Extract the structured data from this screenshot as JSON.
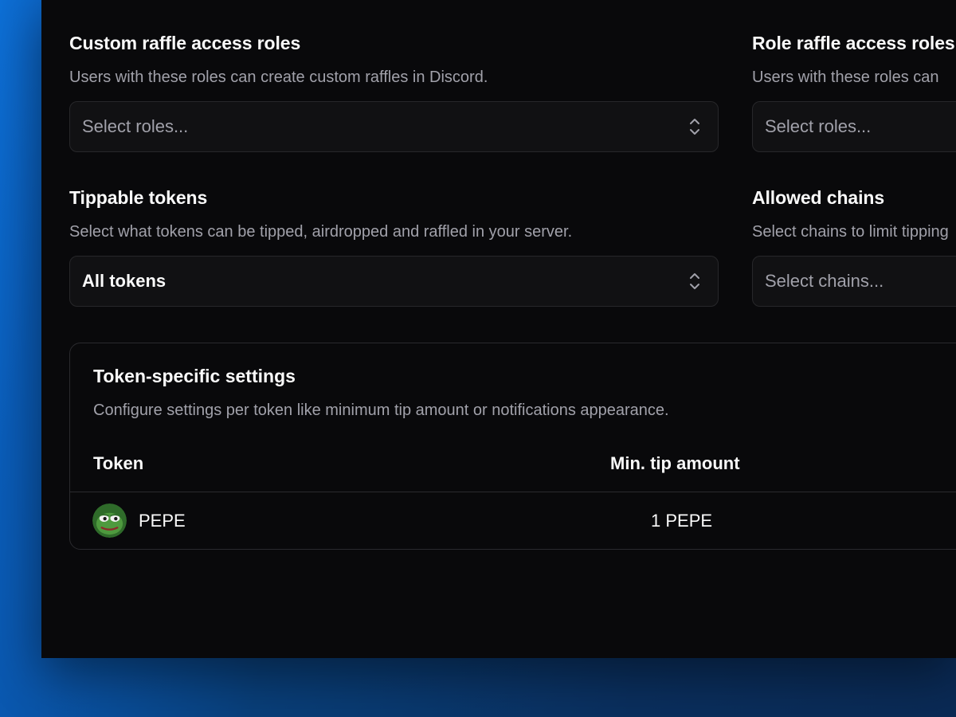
{
  "fields": {
    "custom_raffle": {
      "title": "Custom raffle access roles",
      "description": "Users with these roles can create custom raffles in Discord.",
      "placeholder": "Select roles..."
    },
    "role_raffle": {
      "title": "Role raffle access roles",
      "description": "Users with these roles can",
      "placeholder": "Select roles..."
    },
    "tippable_tokens": {
      "title": "Tippable tokens",
      "description": "Select what tokens can be tipped, airdropped and raffled in your server.",
      "value": "All tokens"
    },
    "allowed_chains": {
      "title": "Allowed chains",
      "description": "Select chains to limit tipping",
      "placeholder": "Select chains..."
    }
  },
  "token_settings": {
    "title": "Token-specific settings",
    "description": "Configure settings per token like minimum tip amount or notifications appearance.",
    "columns": [
      "Token",
      "Min. tip amount"
    ],
    "rows": [
      {
        "token": "PEPE",
        "min_tip": "1 PEPE",
        "icon": "pepe-frog-icon"
      }
    ]
  },
  "colors": {
    "panel_bg": "#09090b",
    "border": "#27272a",
    "text_primary": "#fafafa",
    "text_muted": "#a1a1aa",
    "backdrop_blue": "#0d6fd6"
  }
}
